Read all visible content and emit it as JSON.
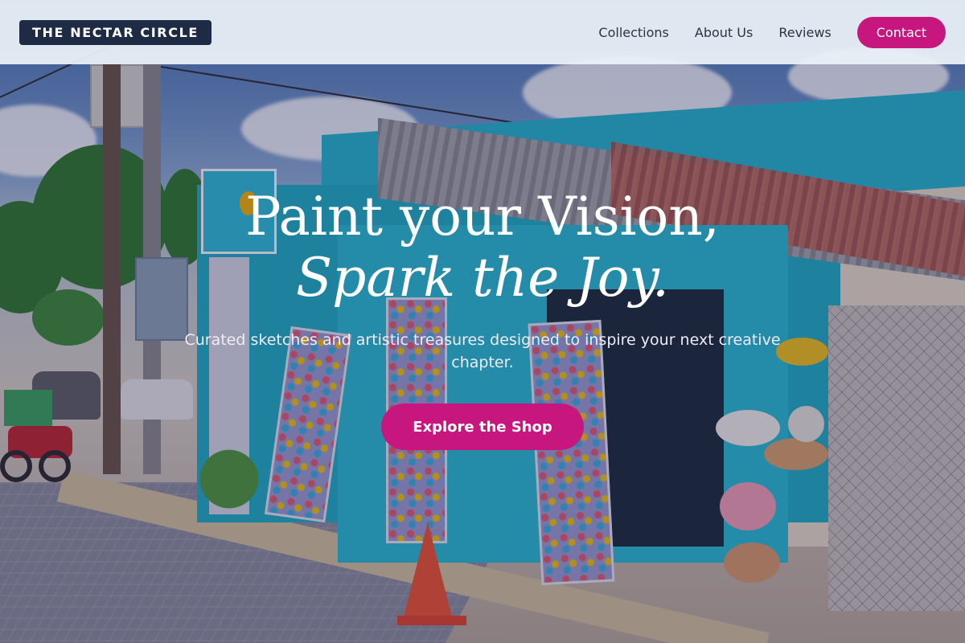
{
  "header": {
    "logo": "THE NECTAR CIRCLE",
    "nav": [
      "Collections",
      "About Us",
      "Reviews"
    ],
    "contact_label": "Contact"
  },
  "hero": {
    "headline_line1": "Paint your Vision,",
    "headline_line2": "Spark the Joy.",
    "subtitle": "Curated sketches and artistic treasures designed to inspire your next creative chapter.",
    "cta_label": "Explore the Shop"
  },
  "colors": {
    "accent": "#c8167f",
    "logo_bg": "#1f2a44",
    "header_bg": "#ecf2f8"
  }
}
